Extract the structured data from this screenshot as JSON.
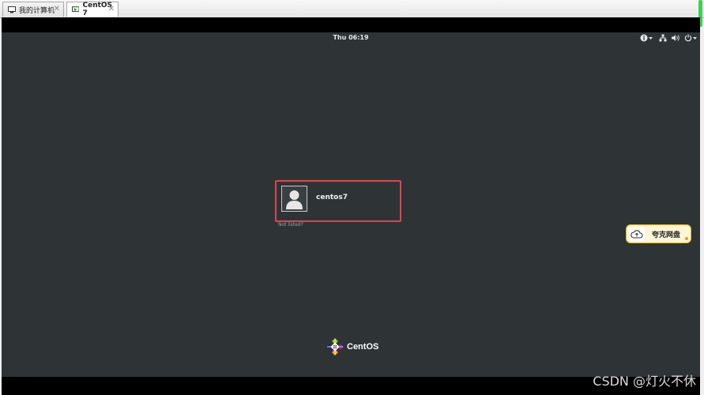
{
  "tabs": [
    {
      "label": "我的计算机",
      "icon": "computer-icon",
      "close": "✕"
    },
    {
      "label": "CentOS 7",
      "icon": "vm-icon",
      "close": "✕"
    }
  ],
  "topbar": {
    "clock": "Thu 06:19",
    "icons": [
      "accessibility-icon",
      "network-icon",
      "volume-icon",
      "power-icon"
    ]
  },
  "login": {
    "username": "centos7",
    "not_listed": "Not listed?"
  },
  "brand": {
    "name": "CentOS"
  },
  "popup": {
    "label": "夸克网盘"
  },
  "watermark": "CSDN @灯火不休",
  "colors": {
    "screen": "#2e3436",
    "highlight_border": "#e0434f",
    "popup_bg": "#fff6d8",
    "popup_border": "#f0b020"
  }
}
